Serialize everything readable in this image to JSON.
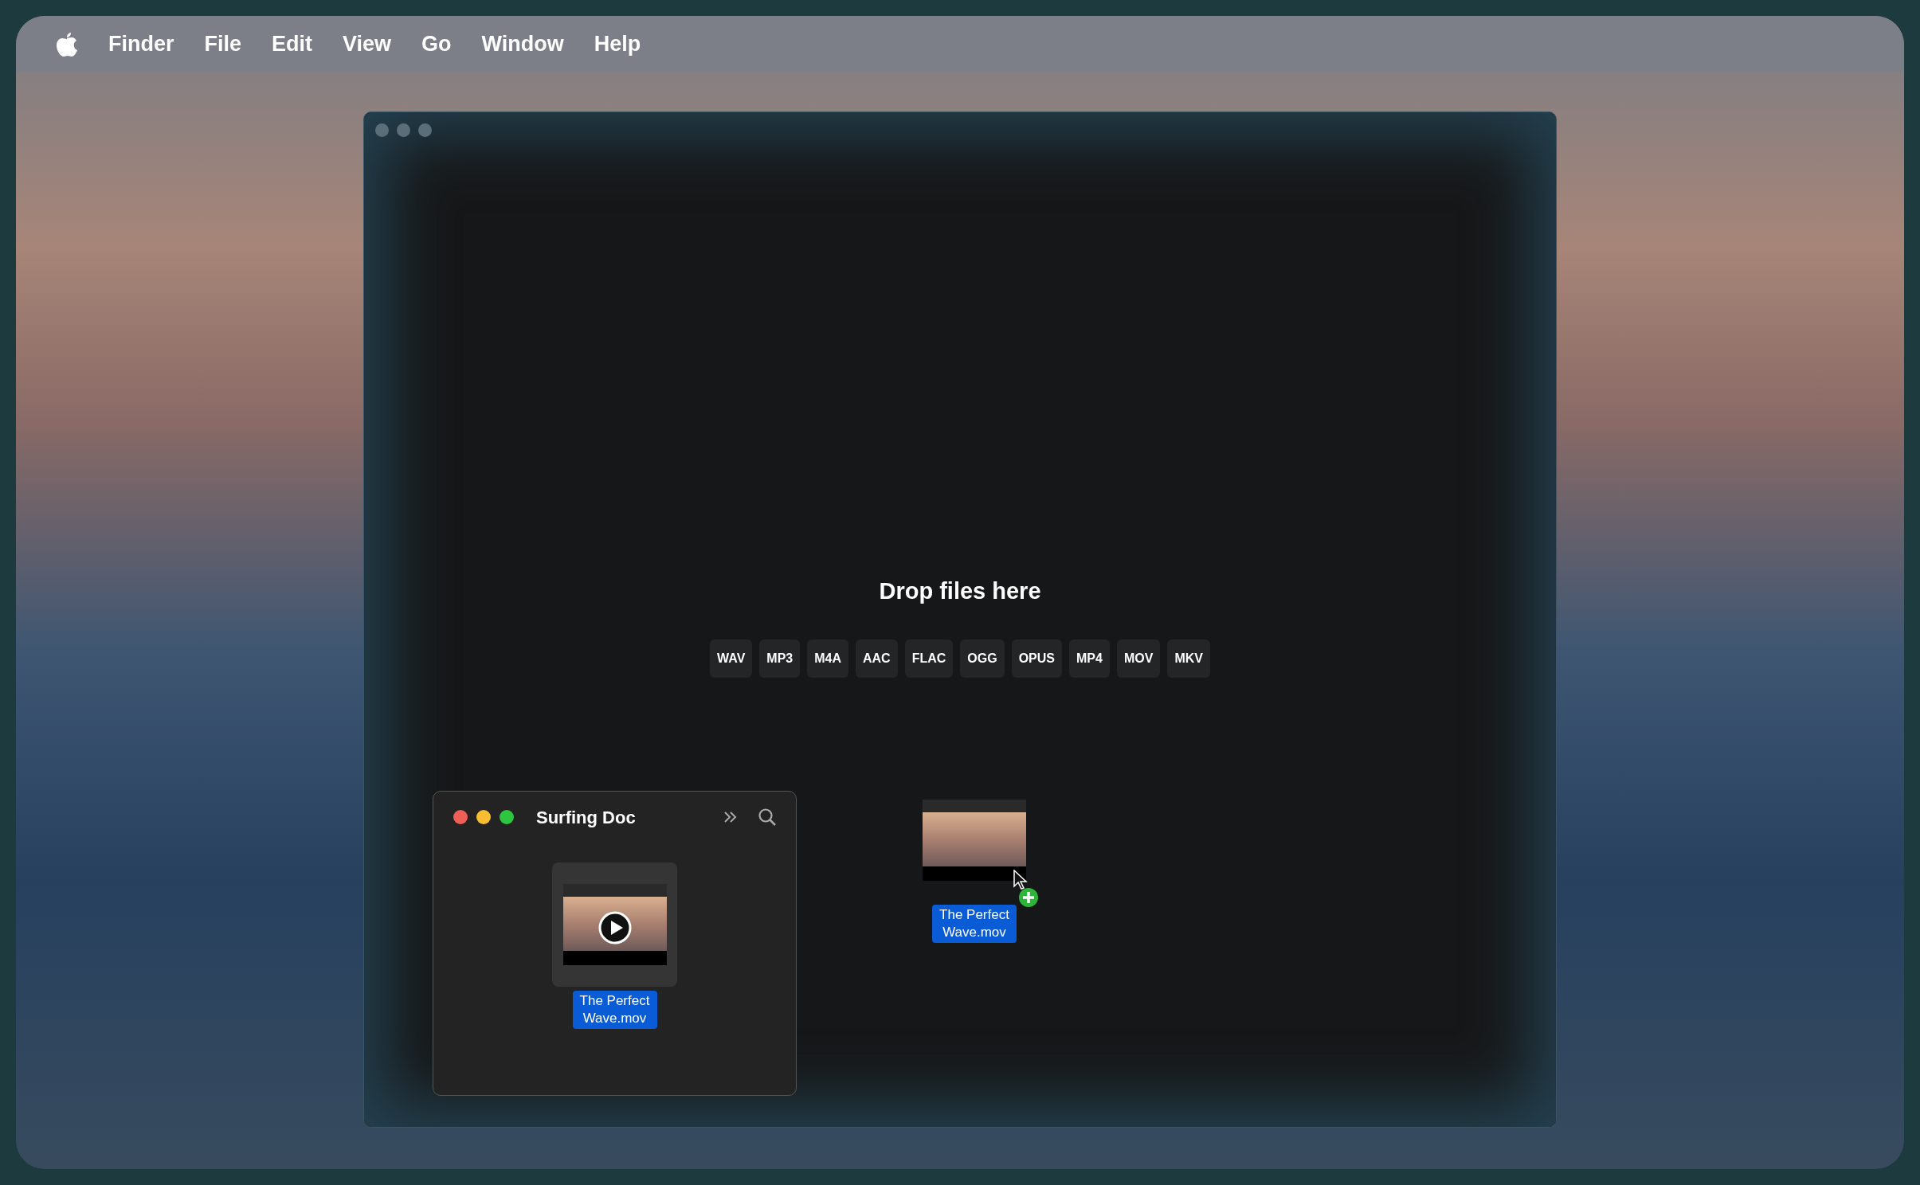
{
  "menu_bar": {
    "items": [
      "Finder",
      "File",
      "Edit",
      "View",
      "Go",
      "Window",
      "Help"
    ]
  },
  "app_window": {
    "drop_zone": {
      "title": "Drop files here",
      "formats": [
        "WAV",
        "MP3",
        "M4A",
        "AAC",
        "FLAC",
        "OGG",
        "OPUS",
        "MP4",
        "MOV",
        "MKV"
      ]
    }
  },
  "finder_window": {
    "title": "Surfing Doc",
    "files": [
      {
        "name": "The Perfect Wave.mov",
        "selected": true
      }
    ]
  },
  "dragged_file": {
    "name": "The Perfect Wave.mov",
    "selected": true
  }
}
